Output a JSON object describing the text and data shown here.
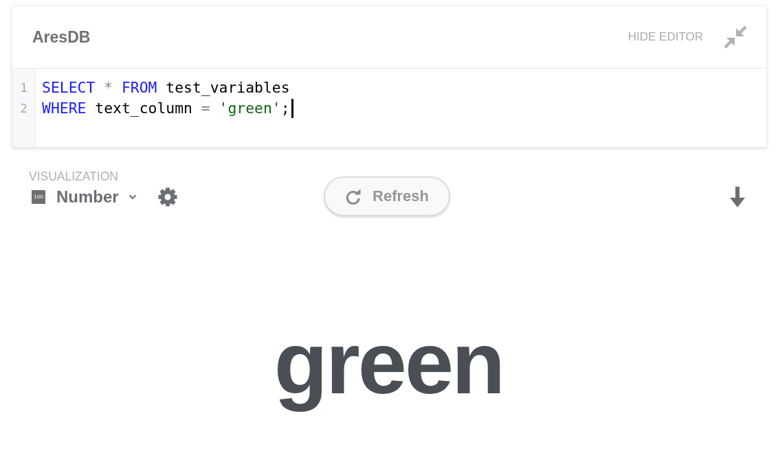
{
  "editor": {
    "title": "AresDB",
    "hide_button": "HIDE EDITOR",
    "lines": [
      {
        "number": "1",
        "cursor": false,
        "tokens": [
          {
            "kind": "keyword",
            "text": "SELECT"
          },
          {
            "kind": "operator",
            "text": " * "
          },
          {
            "kind": "keyword",
            "text": "FROM"
          },
          {
            "kind": "plain",
            "text": " test_variables"
          }
        ]
      },
      {
        "number": "2",
        "cursor": true,
        "tokens": [
          {
            "kind": "keyword",
            "text": "WHERE"
          },
          {
            "kind": "plain",
            "text": " text_column "
          },
          {
            "kind": "operator",
            "text": "= "
          },
          {
            "kind": "string",
            "text": "'green'"
          },
          {
            "kind": "plain",
            "text": ";"
          }
        ]
      }
    ]
  },
  "visualization": {
    "label": "VISUALIZATION",
    "type_icon": "100",
    "type": "Number"
  },
  "refresh_button": "Refresh",
  "result": "green"
}
